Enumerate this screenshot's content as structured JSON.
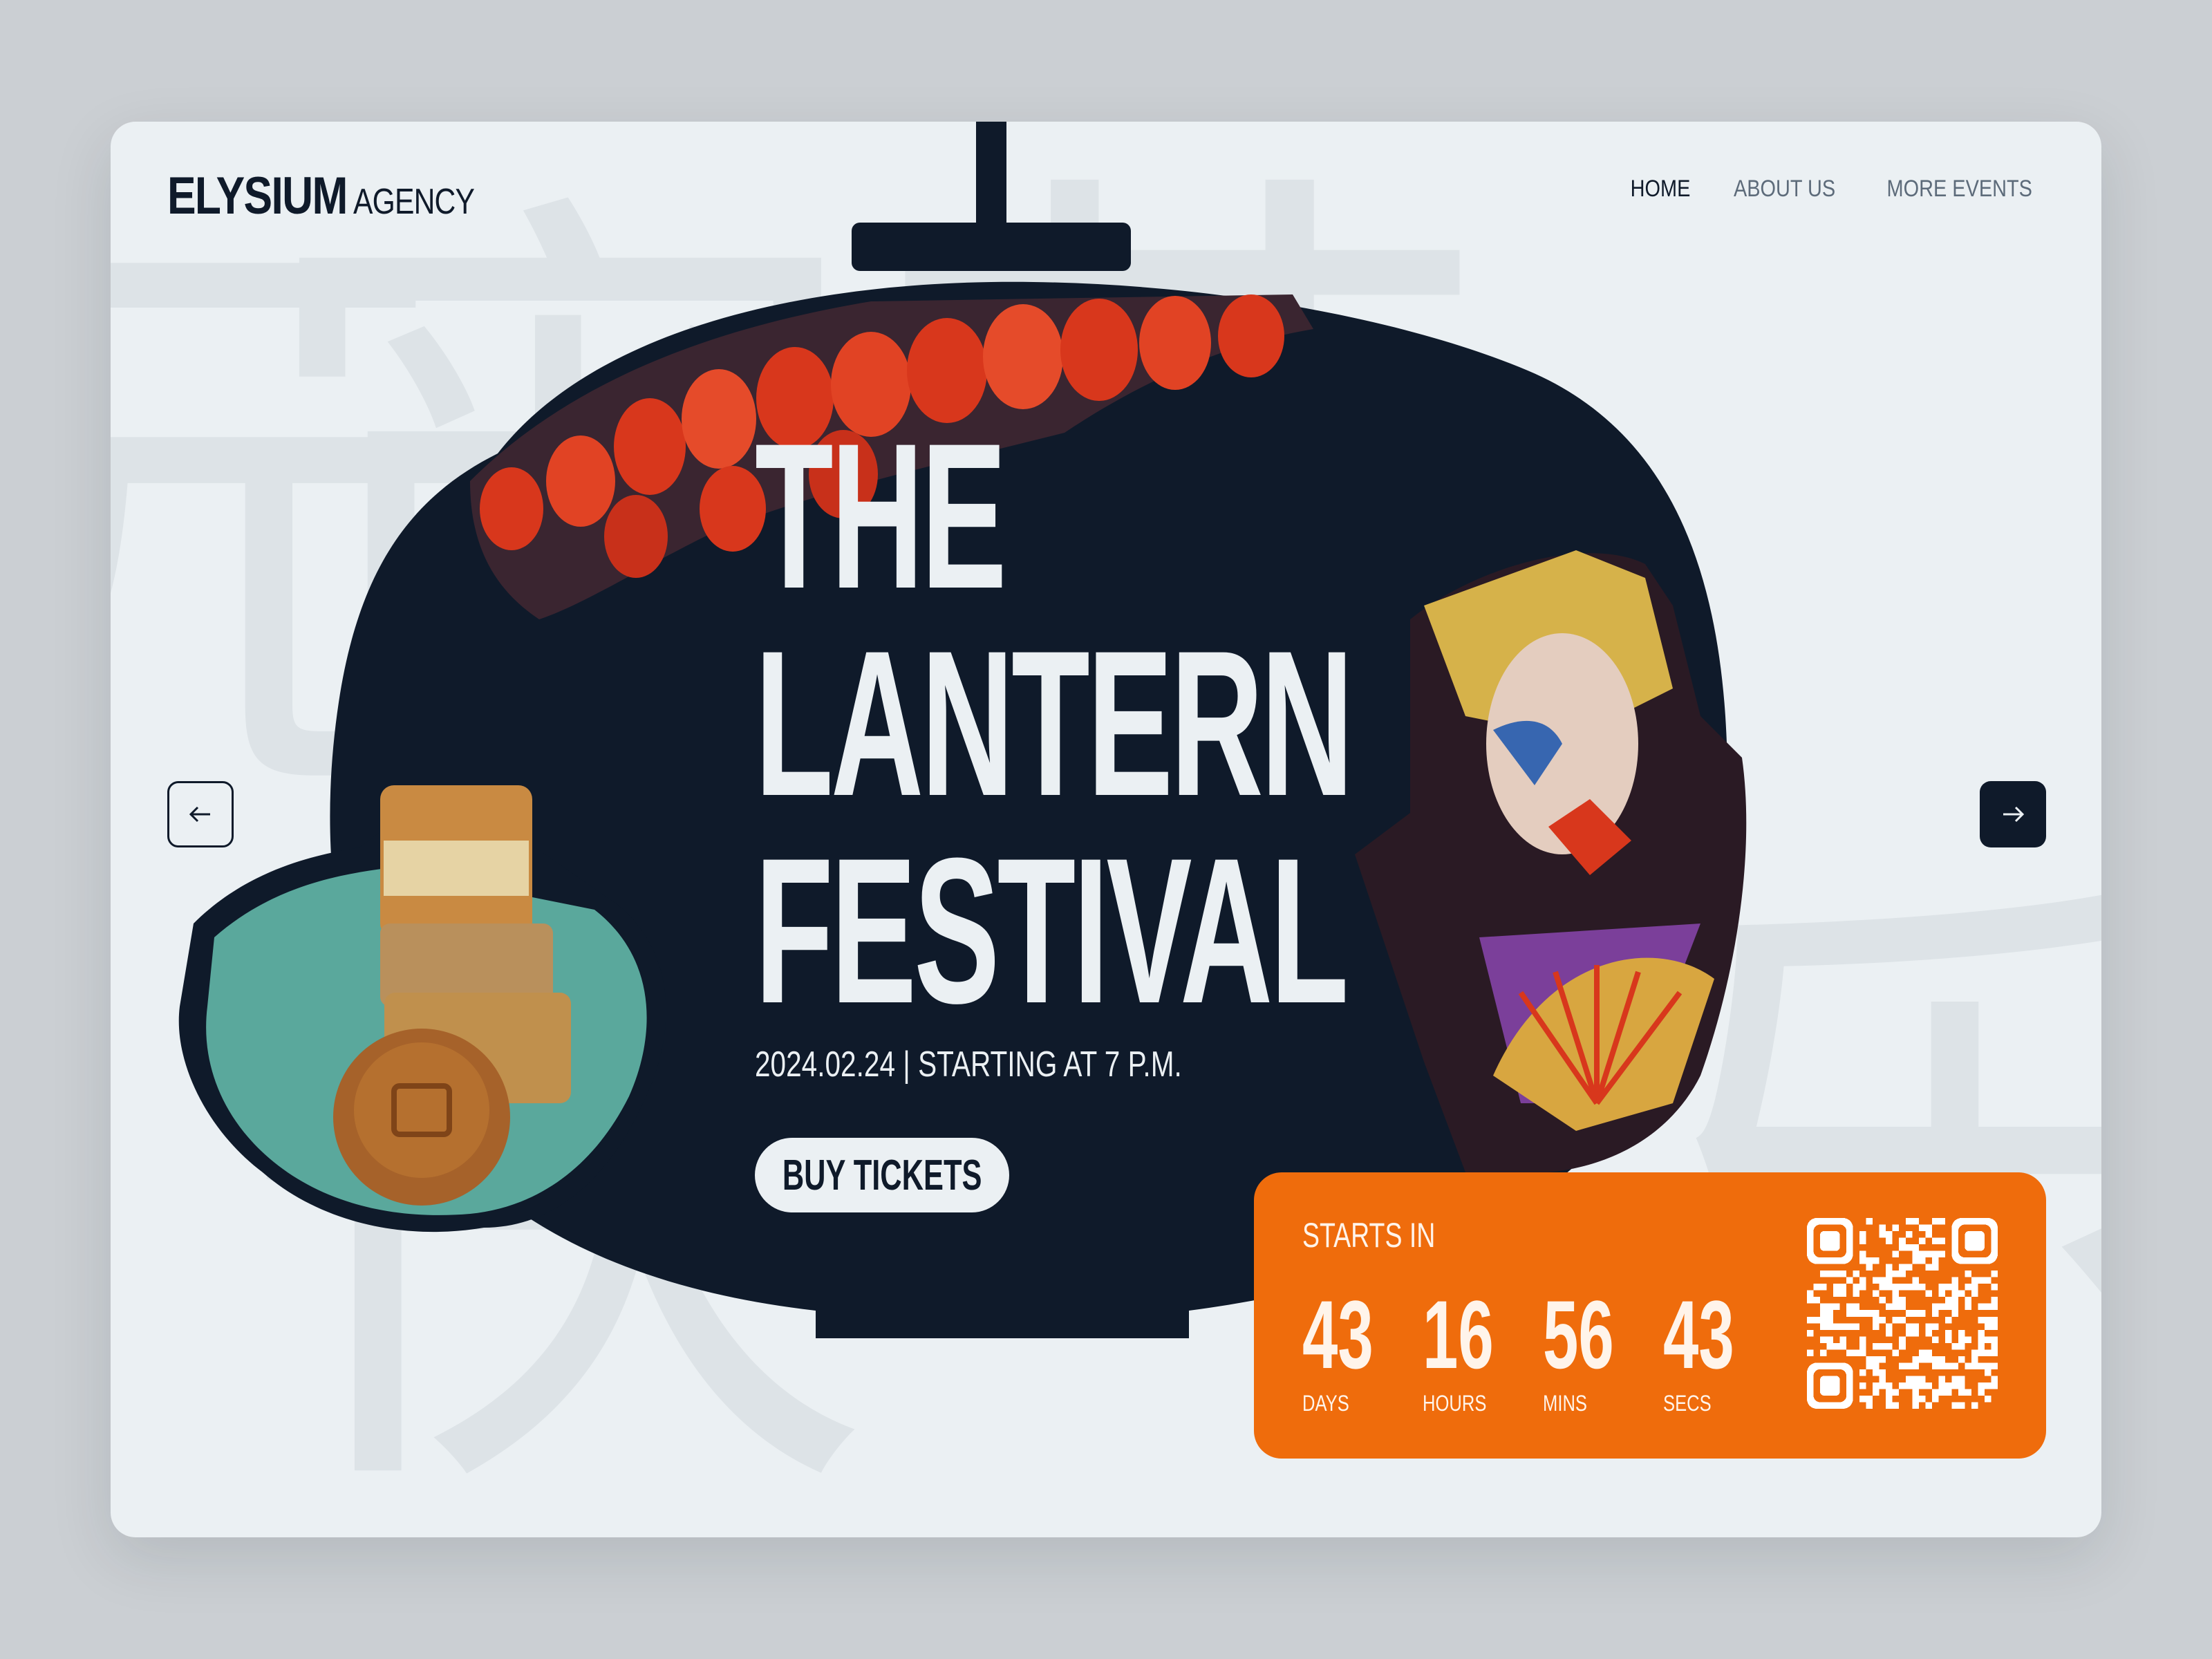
{
  "brand": {
    "name": "ELYSIUM",
    "tagline": "AGENCY"
  },
  "nav": {
    "items": [
      {
        "label": "HOME",
        "active": true
      },
      {
        "label": "ABOUT US",
        "active": false
      },
      {
        "label": "MORE EVENTS",
        "active": false
      }
    ]
  },
  "background_glyphs": [
    "元",
    "宵",
    "节",
    "快",
    "乐"
  ],
  "hero": {
    "title_lines": [
      "THE",
      "LANTERN",
      "FESTIVAL"
    ],
    "date_line": "2024.02.24 | STARTING AT 7 P.M.",
    "cta_label": "BUY TICKETS"
  },
  "carousel": {
    "prev_icon": "arrow-left-icon",
    "next_icon": "arrow-right-icon"
  },
  "countdown": {
    "label": "STARTS IN",
    "units": [
      {
        "value": "43",
        "caption": "DAYS"
      },
      {
        "value": "16",
        "caption": "HOURS"
      },
      {
        "value": "56",
        "caption": "MINS"
      },
      {
        "value": "43",
        "caption": "SECS"
      }
    ],
    "qr_icon": "qr-code-icon"
  },
  "colors": {
    "navy": "#0f1a2a",
    "background": "#ebf0f3",
    "accent_orange": "#ef6c0c",
    "lantern_red": "#d8371c"
  }
}
